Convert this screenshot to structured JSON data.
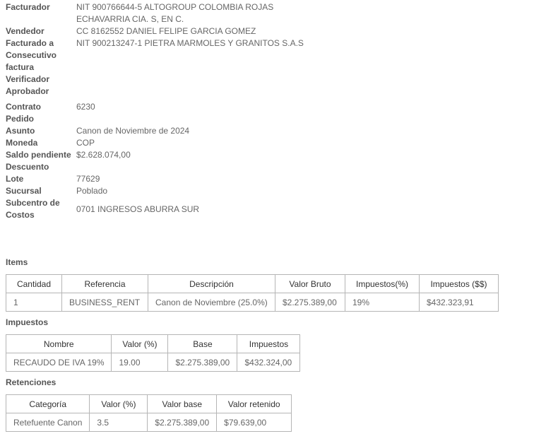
{
  "details_a": [
    {
      "label": "Facturador",
      "lines": [
        "NIT 900766644-5   ALTOGROUP COLOMBIA ROJAS",
        "ECHAVARRIA CIA. S, EN C."
      ]
    },
    {
      "label": "Vendedor",
      "lines": [
        "CC 8162552   DANIEL FELIPE GARCIA GOMEZ"
      ]
    },
    {
      "label": "Facturado a",
      "lines": [
        "NIT 900213247-1   PIETRA MARMOLES Y GRANITOS S.A.S"
      ]
    },
    {
      "label": "Consecutivo factura",
      "lines": [
        ""
      ]
    },
    {
      "label": "Verificador",
      "lines": [
        ""
      ]
    },
    {
      "label": "Aprobador",
      "lines": [
        ""
      ]
    }
  ],
  "details_b": [
    {
      "label": "Contrato",
      "value": "6230"
    },
    {
      "label": "Pedido",
      "value": ""
    },
    {
      "label": "Asunto",
      "value": "Canon de Noviembre de 2024"
    },
    {
      "label": "Moneda",
      "value": "COP"
    },
    {
      "label": "Saldo pendiente",
      "value": "$2.628.074,00"
    },
    {
      "label": "Descuento",
      "value": ""
    },
    {
      "label": "Lote",
      "value": "77629"
    },
    {
      "label": "Sucursal",
      "value": "Poblado"
    },
    {
      "label": "Subcentro de Costos",
      "value": "0701 INGRESOS ABURRA SUR"
    }
  ],
  "items": {
    "title": "Items",
    "headers": [
      "Cantidad",
      "Referencia",
      "Descripción",
      "Valor Bruto",
      "Impuestos(%)",
      "Impuestos ($$)"
    ],
    "rows": [
      [
        "1",
        "BUSINESS_RENT",
        "Canon de Noviembre (25.0%)",
        "$2.275.389,00",
        "19%",
        "$432.323,91"
      ]
    ]
  },
  "impuestos": {
    "title": "Impuestos",
    "headers": [
      "Nombre",
      "Valor (%)",
      "Base",
      "Impuestos"
    ],
    "rows": [
      [
        "RECAUDO DE IVA 19%",
        "19.00",
        "$2.275.389,00",
        "$432.324,00"
      ]
    ]
  },
  "retenciones": {
    "title": "Retenciones",
    "headers": [
      "Categoría",
      "Valor (%)",
      "Valor base",
      "Valor retenido"
    ],
    "rows": [
      [
        "Retefuente Canon",
        "3.5",
        "$2.275.389,00",
        "$79.639,00"
      ]
    ]
  }
}
